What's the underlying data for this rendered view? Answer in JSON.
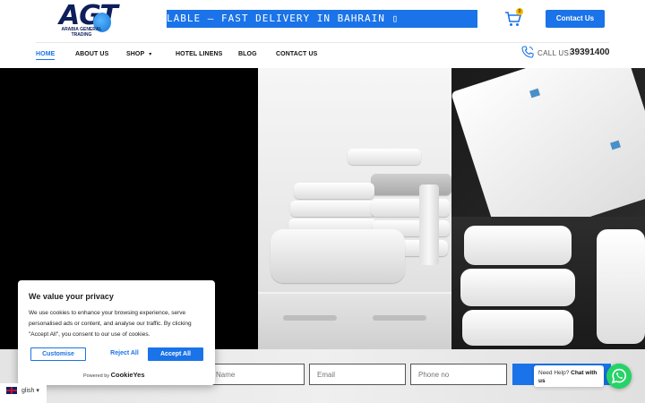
{
  "header": {
    "logo_text": "AGT",
    "logo_sub": "ARABIA GENERAL TRADING",
    "marquee": "LABLE — FAST DELIVERY IN BAHRAIN ▯",
    "cart_count": "0",
    "contact_button": "Contact Us",
    "call_label": "CALL US:",
    "call_number": "39391400"
  },
  "nav": {
    "items": [
      {
        "label": "HOME"
      },
      {
        "label": "ABOUT US"
      },
      {
        "label": "SHOP"
      },
      {
        "label": "HOTEL LINENS"
      },
      {
        "label": "BLOG"
      },
      {
        "label": "CONTACT US"
      }
    ]
  },
  "form": {
    "name_placeholder": "Name",
    "email_placeholder": "Email",
    "phone_placeholder": "Phone no"
  },
  "cookie": {
    "title": "We value your privacy",
    "body": "We use cookies to enhance your browsing experience, serve personalised ads or content, and analyse our traffic. By clicking \"Accept All\", you consent to our use of cookies.",
    "customise": "Customise",
    "reject": "Reject All",
    "accept": "Accept All",
    "powered_by": "Powered by",
    "brand": "CookieYes"
  },
  "language": {
    "label": "glish ▾"
  },
  "whatsapp": {
    "prefix": "Need Help?",
    "cta": "Chat with us"
  },
  "colors": {
    "accent": "#1a73e8",
    "whatsapp": "#25d366"
  }
}
